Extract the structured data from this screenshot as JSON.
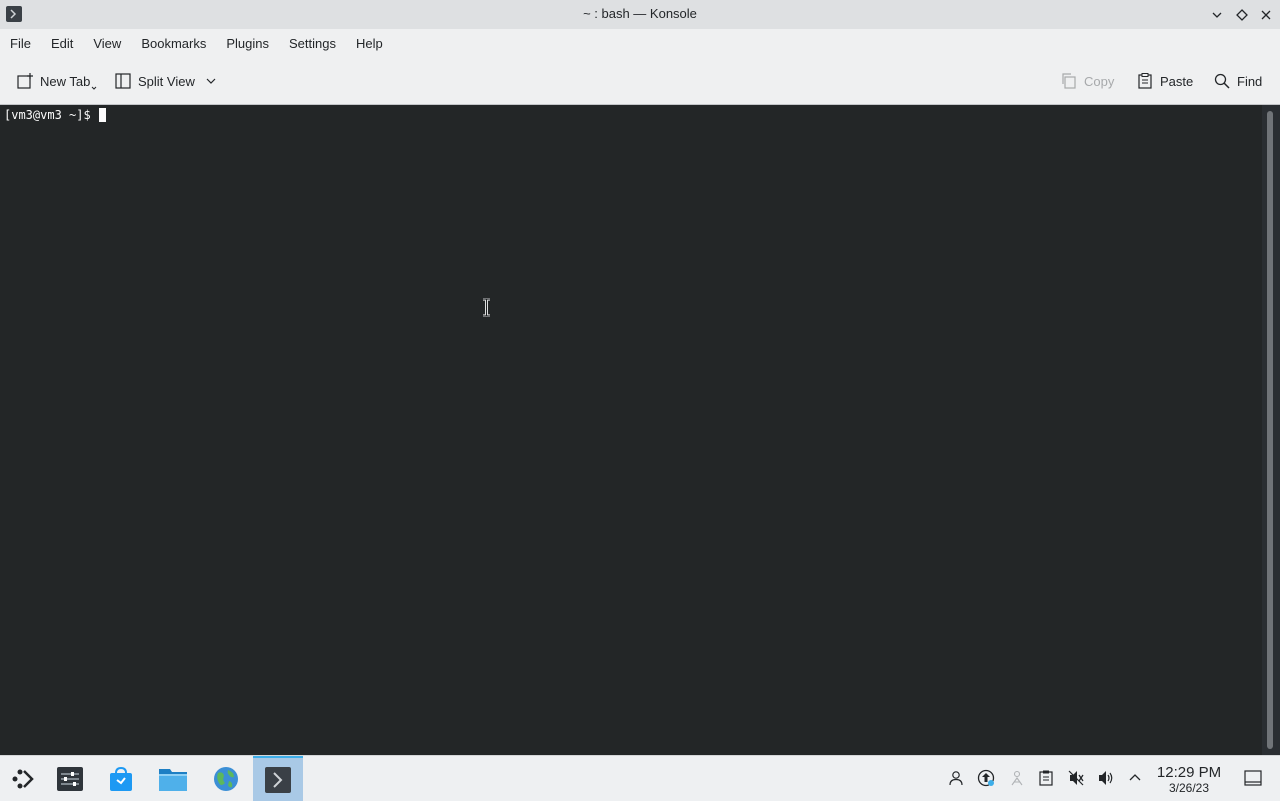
{
  "window": {
    "title": "~ : bash — Konsole",
    "icon": "konsole-icon",
    "controls": [
      "minimize-icon",
      "maximize-icon",
      "close-icon"
    ]
  },
  "menu": [
    "File",
    "Edit",
    "View",
    "Bookmarks",
    "Plugins",
    "Settings",
    "Help"
  ],
  "toolbar": {
    "new_tab": "New Tab",
    "split_view": "Split View",
    "copy": "Copy",
    "paste": "Paste",
    "find": "Find"
  },
  "terminal": {
    "prompt": "[vm3@vm3 ~]$",
    "background": "#232627",
    "foreground": "#fcfcfc"
  },
  "taskbar": {
    "apps": [
      "application-launcher-icon",
      "system-settings-icon",
      "discover-icon",
      "dolphin-file-manager-icon",
      "web-browser-icon",
      "konsole-icon"
    ],
    "tray": [
      "user-icon",
      "update-icon",
      "kde-connect-icon",
      "clipboard-icon",
      "mic-muted-icon",
      "volume-icon",
      "tray-expand-icon"
    ],
    "time": "12:29 PM",
    "date": "3/26/23",
    "accent": "#3daee9"
  }
}
